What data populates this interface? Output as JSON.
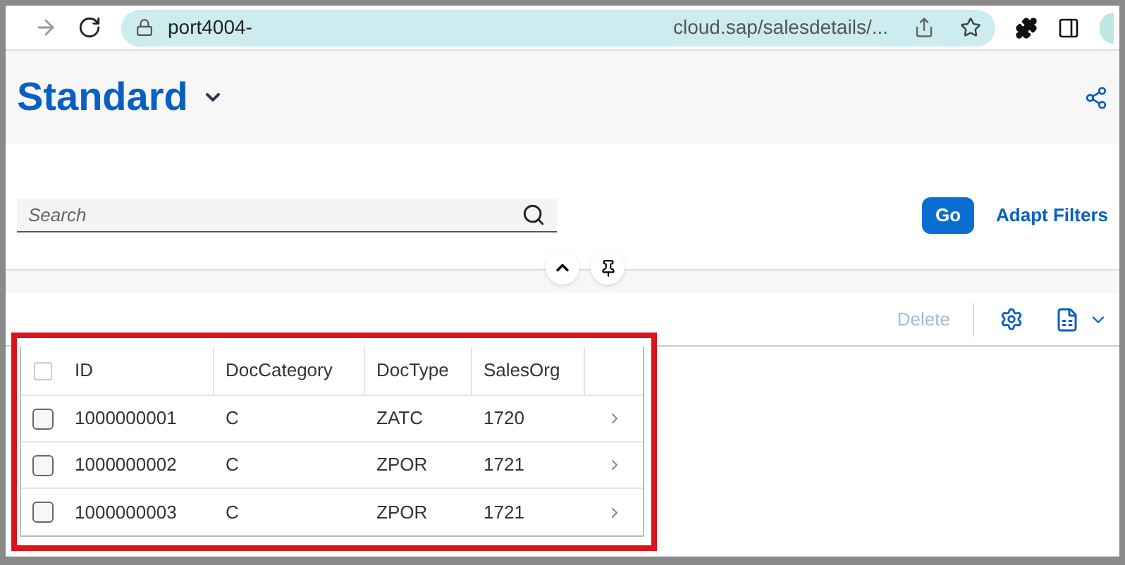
{
  "browser": {
    "url_start": "port4004-",
    "url_end": "cloud.sap/salesdetails/..."
  },
  "header": {
    "title": "Standard"
  },
  "filter_bar": {
    "search": {
      "placeholder": "Search"
    },
    "go": "Go",
    "adapt_filters": "Adapt Filters"
  },
  "toolbar": {
    "delete": {
      "label": "Delete",
      "disabled": true
    }
  },
  "table": {
    "select_all": {
      "checked": false
    },
    "columns": [
      "ID",
      "DocCategory",
      "DocType",
      "SalesOrg"
    ],
    "rows": [
      {
        "cells": [
          "1000000001",
          "C",
          "ZATC",
          "1720"
        ],
        "checked": false
      },
      {
        "cells": [
          "1000000002",
          "C",
          "ZPOR",
          "1721"
        ],
        "checked": false
      },
      {
        "cells": [
          "1000000003",
          "C",
          "ZPOR",
          "1721"
        ],
        "checked": false
      }
    ]
  }
}
